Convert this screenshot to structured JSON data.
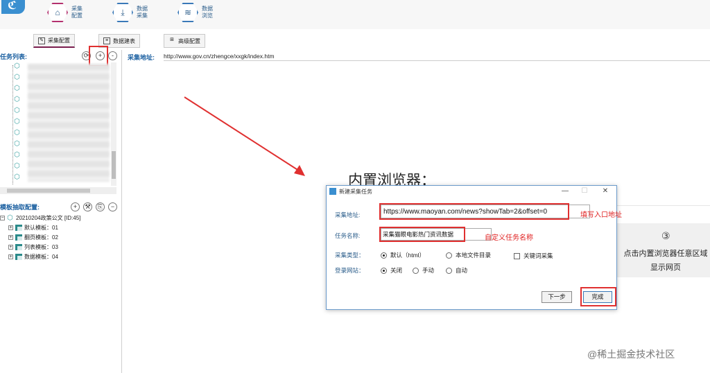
{
  "ribbon": {
    "items": [
      {
        "label_line1": "采集",
        "label_line2": "配置",
        "icon": "home-icon"
      },
      {
        "label_line1": "数据",
        "label_line2": "采集",
        "icon": "download-icon"
      },
      {
        "label_line1": "数据",
        "label_line2": "浏览",
        "icon": "layers-icon"
      }
    ],
    "subbuttons": [
      "采集配置",
      "数据建表",
      "高级配置"
    ]
  },
  "task_list": {
    "title": "任务列表:",
    "buttons": [
      "refresh-icon",
      "+",
      "-"
    ]
  },
  "template_panel": {
    "title": "模板抽取配置:",
    "root": "20210204政策公文 [ID:45]",
    "items": [
      "默认模板：01",
      "翻页模板：02",
      "列表模板：03",
      "数据模板：04"
    ]
  },
  "address": {
    "label": "采集地址:",
    "value": "http://www.gov.cn/zhengce/xxgk/index.htm"
  },
  "browser": {
    "title": "内置浏览器：",
    "step_num": "③",
    "step_text_line1": "点击内置浏览器任意区域",
    "step_text_line2": "显示网页"
  },
  "dialog": {
    "title": "新建采集任务",
    "url_label": "采集地址:",
    "url_value": "https://www.maoyan.com/news?showTab=2&offset=0",
    "name_label": "任务名称:",
    "name_value": "采集猫眼电影热门资讯数据",
    "type_label": "采集类型：",
    "type_options": [
      "默认（html）",
      "本地文件目录"
    ],
    "keyword_option": "关键词采集",
    "login_label": "登录网站：",
    "login_options": [
      "关闭",
      "手动",
      "自动"
    ],
    "next_button": "下一步",
    "finish_button": "完成",
    "annot_url": "填写入口地址",
    "annot_name": "自定义任务名称"
  },
  "watermark": "@稀土掘金技术社区",
  "colors": {
    "accent": "#1a5fa0",
    "annotation": "#e02020",
    "brand": "#3a8fd0"
  }
}
